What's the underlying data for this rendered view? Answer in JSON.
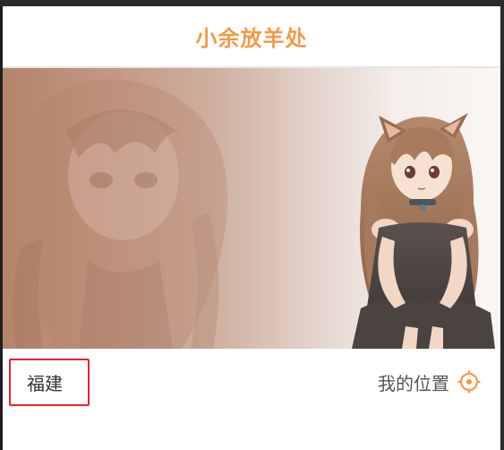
{
  "header": {
    "title": "小余放羊处"
  },
  "banner": {
    "image_description_icon": "anime-girl-banner-image"
  },
  "location": {
    "city": "福建",
    "my_location_label": "我的位置",
    "locate_icon": "crosshair-icon"
  },
  "colors": {
    "accent": "#f39a4c",
    "highlight_box": "#e0262a"
  }
}
